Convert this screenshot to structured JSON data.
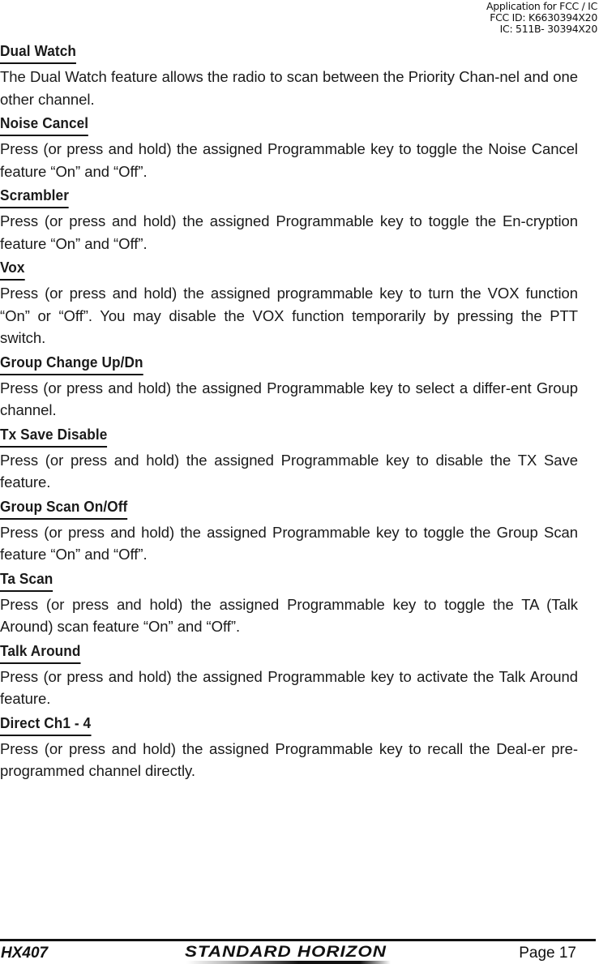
{
  "stamp": {
    "line1": "Application for FCC / IC",
    "line2": "FCC ID: K6630394X20",
    "line3": "IC: 511B- 30394X20"
  },
  "sections": [
    {
      "title": "Dual Watch",
      "body": "The Dual Watch feature allows the radio to scan between the Priority Chan-nel and one other channel."
    },
    {
      "title": "Noise Cancel",
      "body": "Press (or press and hold) the assigned Programmable key to toggle the Noise Cancel feature “On” and “Off”."
    },
    {
      "title": "Scrambler",
      "body": "Press (or press and hold) the assigned Programmable key to toggle the En-cryption feature “On” and “Off”."
    },
    {
      "title": "Vox",
      "body": "Press (or press and hold) the assigned programmable key to turn the VOX function “On” or “Off”. You may disable the VOX function temporarily by pressing the PTT switch."
    },
    {
      "title": "Group Change Up/Dn",
      "body": "Press (or press and hold) the assigned Programmable key to select a differ-ent Group channel."
    },
    {
      "title": "Tx Save Disable",
      "body": "Press (or press and hold) the assigned Programmable key to disable the TX Save feature."
    },
    {
      "title": "Group Scan On/Off",
      "body": "Press (or press and hold) the assigned Programmable key to toggle the Group Scan feature “On” and “Off”."
    },
    {
      "title": "Ta Scan",
      "body": "Press (or press and hold) the assigned Programmable key to toggle the TA (Talk Around) scan feature “On” and “Off”."
    },
    {
      "title": "Talk Around",
      "body": "Press (or press and hold) the assigned Programmable key to activate the Talk Around feature."
    },
    {
      "title": "Direct Ch1 - 4",
      "body": "Press (or press and hold) the assigned Programmable key to recall the Deal-er pre-programmed channel directly."
    }
  ],
  "footer": {
    "model": "HX407",
    "brand": "STANDARD HORIZON",
    "page": "Page 17"
  }
}
